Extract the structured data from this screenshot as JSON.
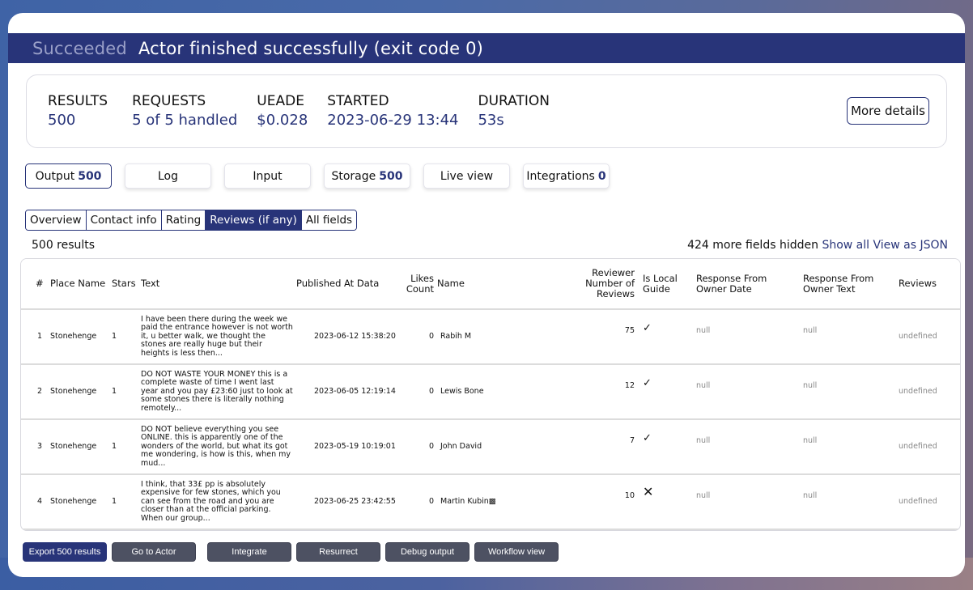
{
  "status": {
    "label": "Succeeded",
    "message": "Actor finished successfully (exit code 0)"
  },
  "stats": [
    {
      "label": "RESULTS",
      "value": "500"
    },
    {
      "label": "REQUESTS",
      "value": "5 of 5 handled"
    },
    {
      "label": "UEADE",
      "value": "$0.028"
    },
    {
      "label": "STARTED",
      "value": "2023-06-29 13:44"
    },
    {
      "label": "DURATION",
      "value": "53s"
    }
  ],
  "more_details_label": "More details",
  "main_tabs": [
    {
      "label": "Output",
      "count": "500"
    },
    {
      "label": "Log",
      "count": ""
    },
    {
      "label": "Input",
      "count": ""
    },
    {
      "label": "Storage",
      "count": "500"
    },
    {
      "label": "Live view",
      "count": ""
    },
    {
      "label": "Integrations",
      "count": "0"
    }
  ],
  "view_tabs": [
    "Overview",
    "Contact info",
    "Rating",
    "Reviews (if any)",
    "All fields"
  ],
  "results_count": "500 results",
  "fields_hidden": {
    "text": "424 more fields hidden",
    "show_all": "Show all",
    "view_json": "View as JSON"
  },
  "table": {
    "headers": [
      "#",
      "Place Name",
      "Stars",
      "Text",
      "Published At Data",
      "Likes Count",
      "Name",
      "Reviewer Number of Reviews",
      "Is Local Guide",
      "Response From Owner Date",
      "Response From Owner Text",
      "Reviews"
    ],
    "rows": [
      {
        "num": "1",
        "place": "Stonehenge",
        "stars": "1",
        "text": "I have been there during the week we paid the entrance however is not worth it, u better walk, we thought the stones are really huge but their heights is less then...",
        "published": "2023-06-12 15:38:20",
        "likes": "0",
        "name": "Rabih M",
        "reviewer_reviews": "75",
        "local_guide": "✓",
        "owner_date": "null",
        "owner_text": "null",
        "reviews": "undefined"
      },
      {
        "num": "2",
        "place": "Stonehenge",
        "stars": "1",
        "text": "DO NOT WASTE YOUR MONEY this is a complete waste of time I went last year and you pay £23:60 just to look at some stones there is literally nothing remotely...",
        "published": "2023-06-05 12:19:14",
        "likes": "0",
        "name": "Lewis Bone",
        "reviewer_reviews": "12",
        "local_guide": "✓",
        "owner_date": "null",
        "owner_text": "null",
        "reviews": "undefined"
      },
      {
        "num": "3",
        "place": "Stonehenge",
        "stars": "1",
        "text": "DO NOT believe everything you see ONLINE. this is apparently one of the wonders of the world, but what its got me wondering, is how is this, when my mud...",
        "published": "2023-05-19 10:19:01",
        "likes": "0",
        "name": "John David",
        "reviewer_reviews": "7",
        "local_guide": "✓",
        "owner_date": "null",
        "owner_text": "null",
        "reviews": "undefined"
      },
      {
        "num": "4",
        "place": "Stonehenge",
        "stars": "1",
        "text": "I think, that 33£ pp is absolutely expensive for few stones, which you can see from the road and you are closer than at the official parking. When our group...",
        "published": "2023-06-25 23:42:55",
        "likes": "0",
        "name": "Martin Kubin▩",
        "reviewer_reviews": "10",
        "local_guide": "✕",
        "owner_date": "null",
        "owner_text": "null",
        "reviews": "undefined"
      }
    ]
  },
  "actions": [
    "Export 500 results",
    "Go to Actor",
    "Integrate",
    "Resurrect",
    "Debug output",
    "Workflow view"
  ],
  "colors": {
    "brand": "#283479",
    "action_gray": "#4d5162"
  }
}
